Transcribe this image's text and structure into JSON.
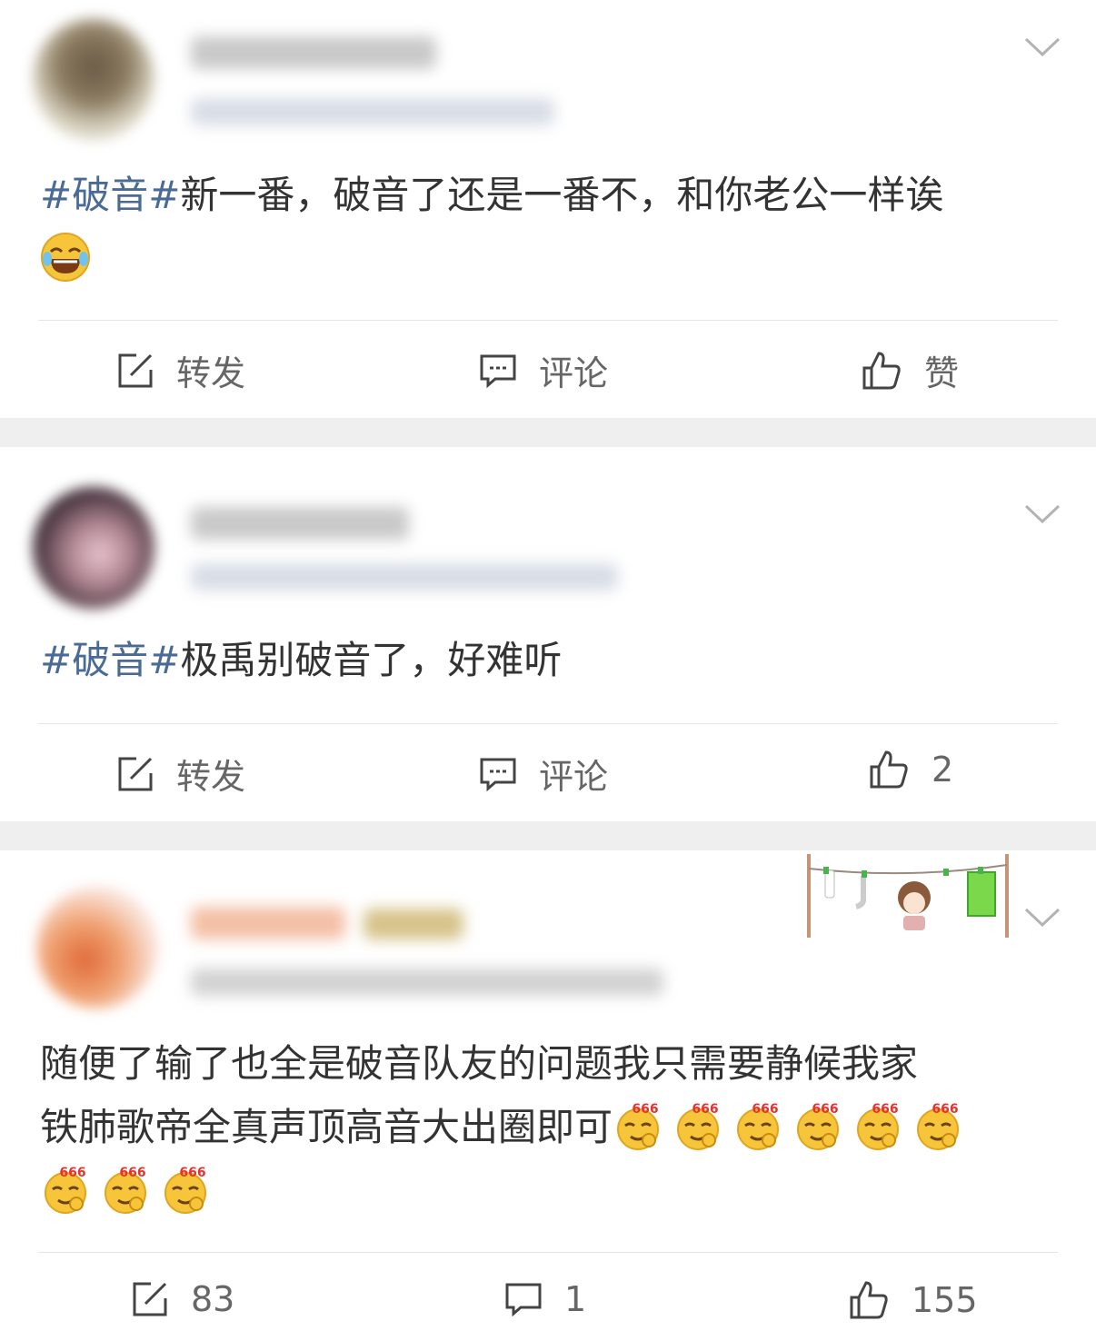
{
  "posts": [
    {
      "hashtag": "#破音#",
      "text": "新一番，破音了还是一番不，和你老公一样诶",
      "emoji": "laughing-crying-emoji",
      "actions": {
        "repost": "转发",
        "comment": "评论",
        "like": "赞"
      }
    },
    {
      "hashtag": "#破音#",
      "text": "极禹别破音了，好难听",
      "actions": {
        "repost": "转发",
        "comment": "评论",
        "like": "2"
      }
    },
    {
      "line1": "随便了输了也全是破音队友的问题我只需要静候我家",
      "line2": "铁肺歌帝全真声顶高音大出圈即可",
      "emoji": "666-emoji",
      "emoji_count": 9,
      "emoji_label": "666",
      "actions": {
        "repost": "83",
        "comment": "1",
        "like": "155"
      }
    }
  ],
  "colors": {
    "hashtag": "#4a6b95",
    "text": "#333333",
    "action": "#666666",
    "separator": "#efefef"
  }
}
